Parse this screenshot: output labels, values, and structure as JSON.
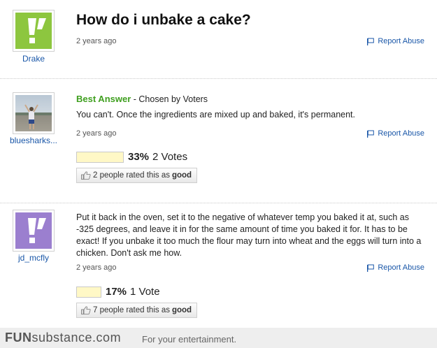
{
  "question": {
    "title": "How do i unbake a cake?",
    "asker": "Drake",
    "time": "2 years ago",
    "report_label": "Report Abuse",
    "avatar_color": "#8dc63f"
  },
  "best_answer": {
    "label": "Best Answer",
    "chosen_by": " - Chosen by Voters",
    "user": "bluesharks...",
    "text": "You can't. Once the ingredients are mixed up and baked, it's permanent.",
    "time": "2 years ago",
    "report_label": "Report Abuse",
    "vote_percent_text": "33%",
    "vote_percent_value": 33,
    "vote_count_text": "2 Votes",
    "rating_prefix": "2 people rated this as ",
    "rating_word": "good"
  },
  "answer2": {
    "user": "jd_mcfly",
    "text": "Put it back in the oven, set it to the negative of whatever temp you baked it at, such as -325 degrees, and leave it in for the same amount of time you baked it for. It has to be exact! If you unbake it too much the flour may turn into wheat and the eggs will turn into a chicken. Don't ask me how.",
    "time": "2 years ago",
    "report_label": "Report Abuse",
    "vote_percent_text": "17%",
    "vote_percent_value": 17,
    "vote_count_text": "1 Vote",
    "rating_prefix": "7 people rated this as ",
    "rating_word": "good",
    "avatar_color": "#9b7fcf"
  },
  "footer": {
    "logo_fun": "FUN",
    "logo_rest": "substance.com",
    "tagline": "For your entertainment."
  }
}
